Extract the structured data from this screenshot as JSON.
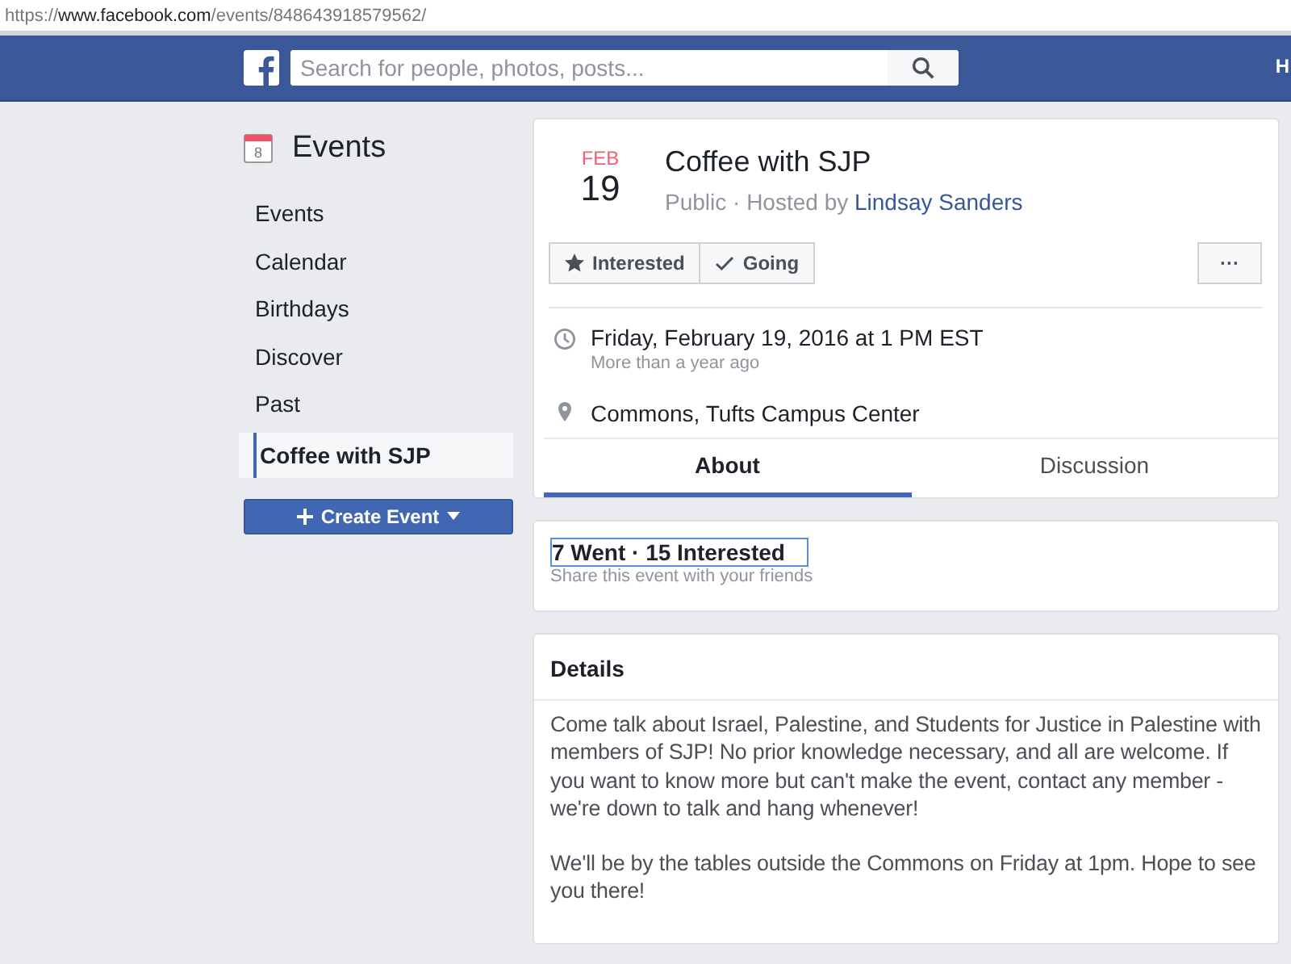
{
  "address_bar": {
    "scheme": "https://",
    "host": "www.facebook.com",
    "path": "/events/848643918579562/"
  },
  "top_bar": {
    "search": {
      "placeholder": "Search for people, photos, posts..."
    },
    "cut_text": "H"
  },
  "sidebar": {
    "title": "Events",
    "icon_day": "8",
    "items": [
      {
        "label": "Events",
        "selected": false
      },
      {
        "label": "Calendar",
        "selected": false
      },
      {
        "label": "Birthdays",
        "selected": false
      },
      {
        "label": "Discover",
        "selected": false
      },
      {
        "label": "Past",
        "selected": false
      },
      {
        "label": "Coffee with SJP",
        "selected": true
      }
    ],
    "create_button": "Create Event"
  },
  "event": {
    "month": "FEB",
    "day": "19",
    "title": "Coffee with SJP",
    "privacy": "Public · Hosted by",
    "host": "Lindsay Sanders",
    "actions": [
      {
        "kind": "star",
        "label": "Interested"
      },
      {
        "kind": "check",
        "label": "Going"
      }
    ],
    "more": "···",
    "when": "Friday, February 19, 2016 at 1 PM EST",
    "when_note": "More than a year ago",
    "where": "Commons, Tufts Campus Center",
    "tabs": [
      {
        "label": "About",
        "selected": true
      },
      {
        "label": "Discussion",
        "selected": false
      }
    ]
  },
  "stats": {
    "text": "7 Went · 15 Interested",
    "focused": true,
    "note": "Share this event with your friends"
  },
  "details": {
    "heading": "Details",
    "paragraphs": [
      "Come talk about Israel, Palestine, and Students for Justice in Palestine with members of SJP! No prior knowledge necessary, and all are welcome. If you want to know more but can't make the event, contact any member - we're down to talk and hang whenever!",
      "We'll be by the tables outside the Commons on Friday at 1pm. Hope to see you there!"
    ]
  }
}
